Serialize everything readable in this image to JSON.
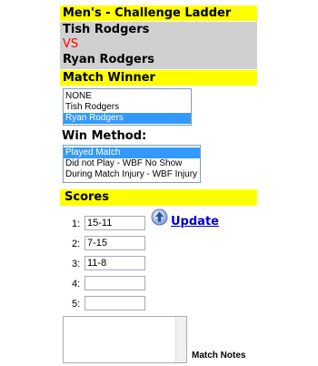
{
  "header": {
    "title": "Men's - Challenge Ladder"
  },
  "match": {
    "player1": "Tish Rodgers",
    "vs": "VS",
    "player2": "Ryan Rodgers"
  },
  "winner": {
    "heading": "Match Winner",
    "options": [
      "NONE",
      "Tish Rodgers",
      "Ryan Rodgers"
    ],
    "selected": "Ryan Rodgers"
  },
  "win_method": {
    "heading": "Win Method:",
    "options": [
      "Played Match",
      "Did not Play - WBF No Show",
      "During Match Injury - WBF Injury"
    ],
    "selected": "Played Match"
  },
  "scores": {
    "heading": "Scores",
    "rows": [
      {
        "label": "1:",
        "value": "15-11"
      },
      {
        "label": "2:",
        "value": "7-15"
      },
      {
        "label": "3:",
        "value": "11-8"
      },
      {
        "label": "4:",
        "value": ""
      },
      {
        "label": "5:",
        "value": ""
      }
    ],
    "update_label": "Update",
    "update_icon": "upload-arrow-icon"
  },
  "notes": {
    "label": "Match Notes",
    "value": ""
  },
  "colors": {
    "header_bg": "#ffff00",
    "players_bg": "#d0d0d0",
    "vs": "#ff0000",
    "selection": "#3399ff",
    "link": "#0000cc"
  }
}
